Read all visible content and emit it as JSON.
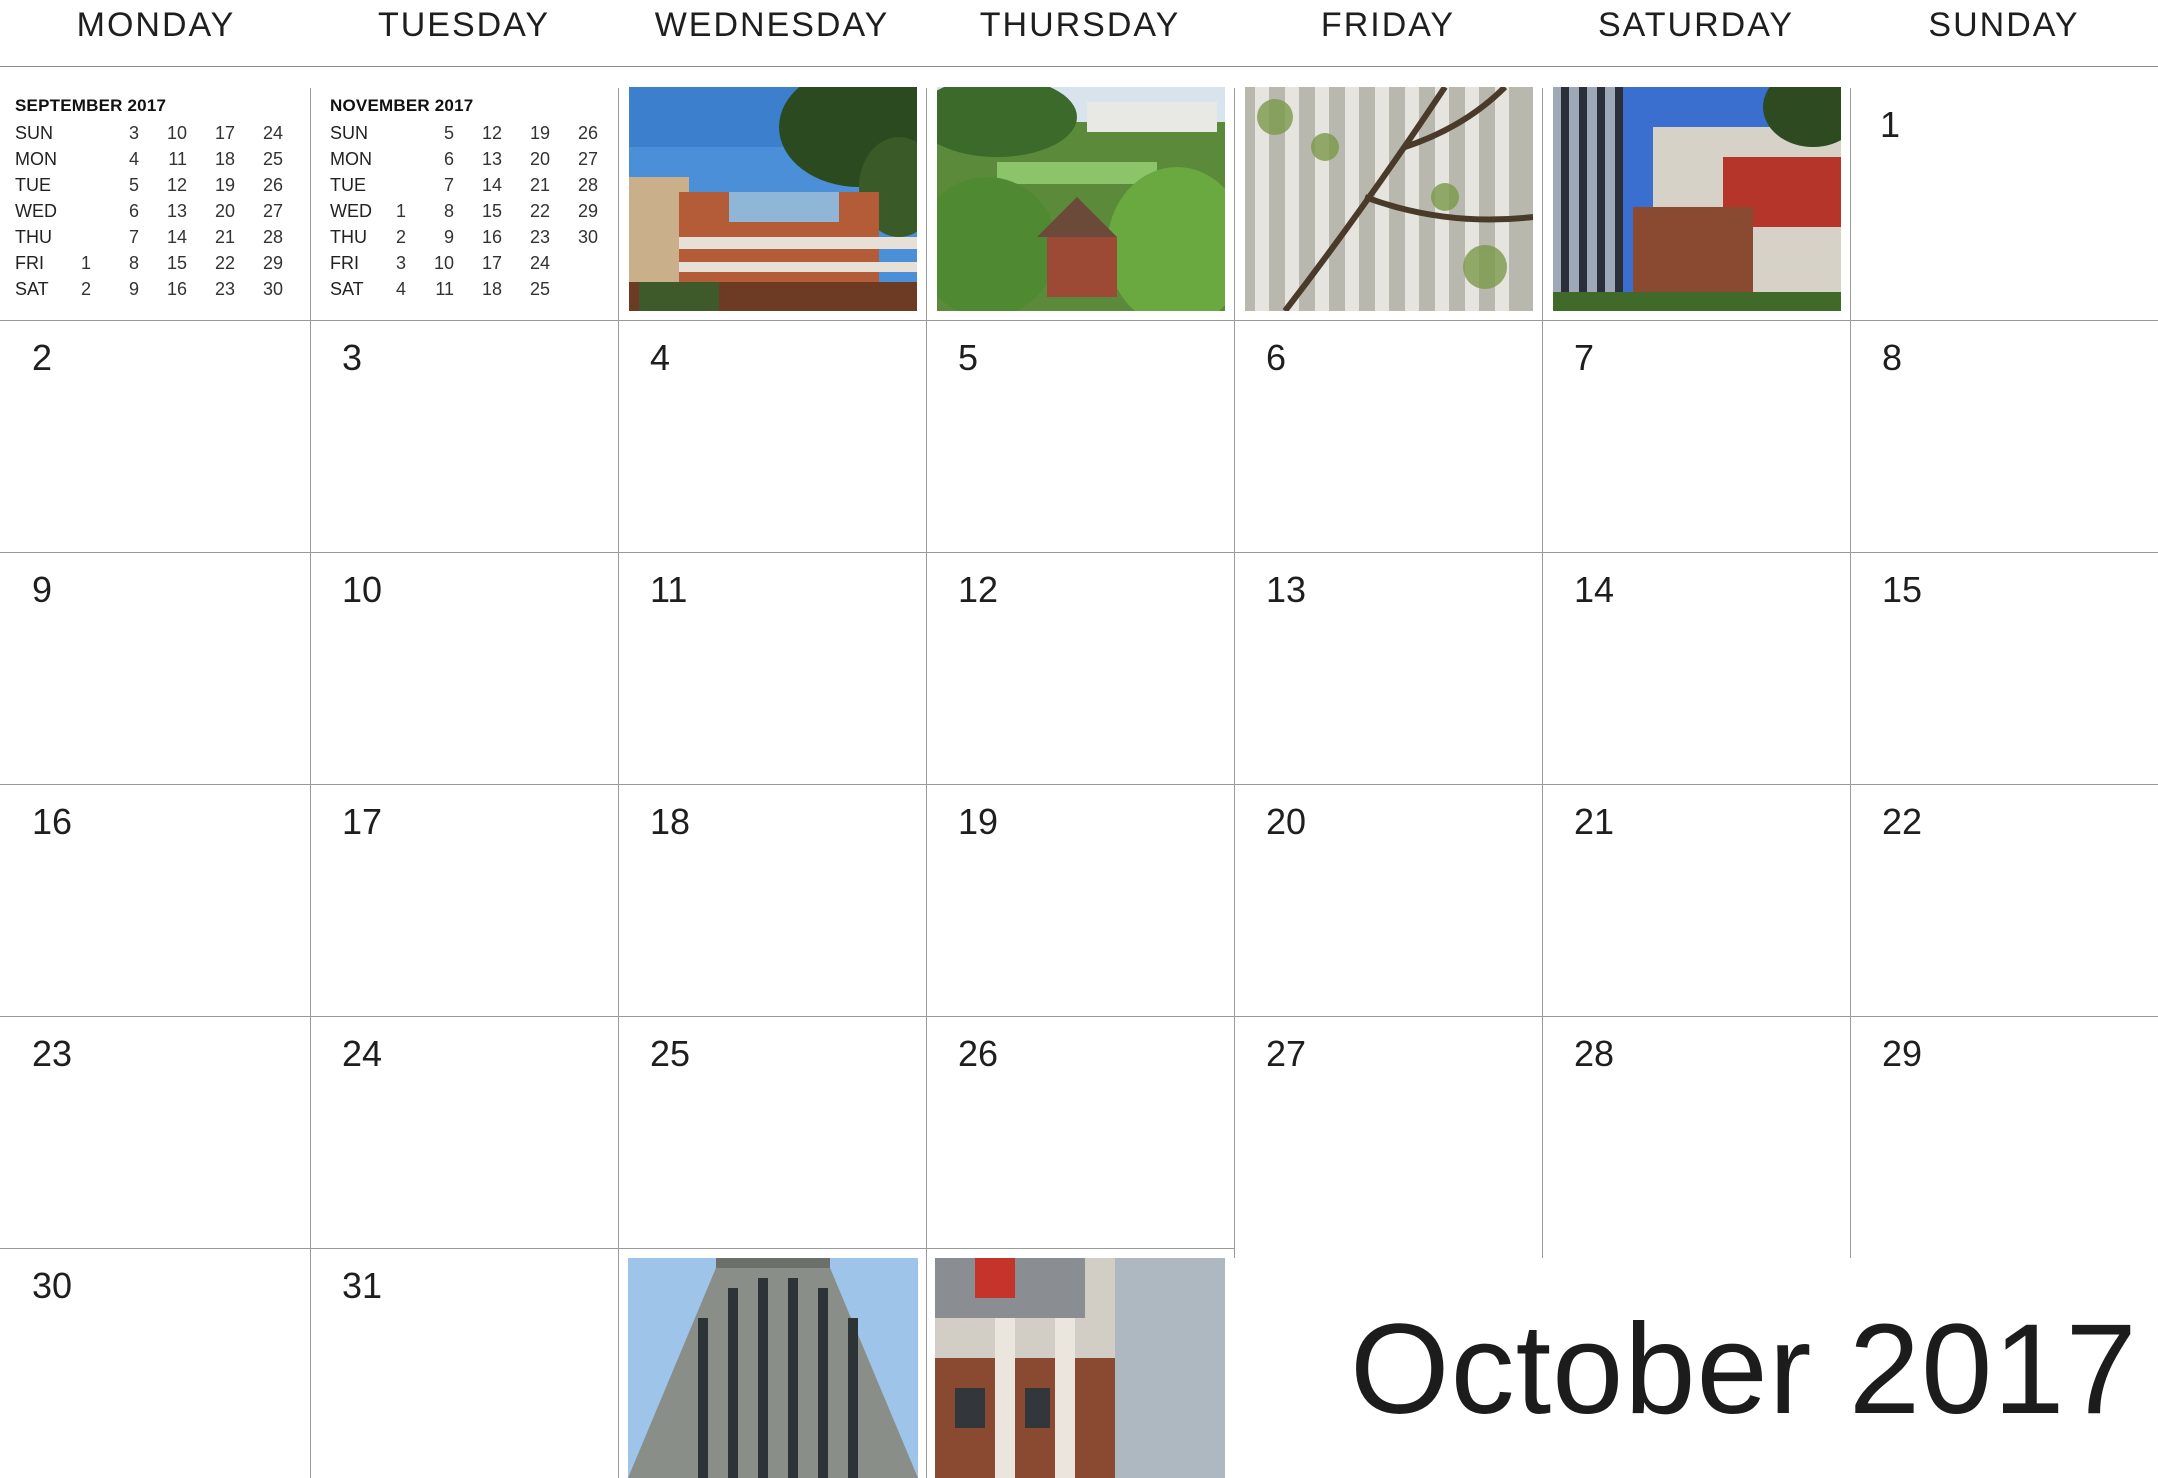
{
  "weekdays": [
    "MONDAY",
    "TUESDAY",
    "WEDNESDAY",
    "THURSDAY",
    "FRIDAY",
    "SATURDAY",
    "SUNDAY"
  ],
  "month_title": "October 2017",
  "days": [
    "1",
    "2",
    "3",
    "4",
    "5",
    "6",
    "7",
    "8",
    "9",
    "10",
    "11",
    "12",
    "13",
    "14",
    "15",
    "16",
    "17",
    "18",
    "19",
    "20",
    "21",
    "22",
    "23",
    "24",
    "25",
    "26",
    "27",
    "28",
    "29",
    "30",
    "31"
  ],
  "mini_calendars": [
    {
      "title": "SEPTEMBER 2017",
      "rows": [
        {
          "day": "SUN",
          "dates": [
            "",
            "3",
            "10",
            "17",
            "24"
          ]
        },
        {
          "day": "MON",
          "dates": [
            "",
            "4",
            "11",
            "18",
            "25"
          ]
        },
        {
          "day": "TUE",
          "dates": [
            "",
            "5",
            "12",
            "19",
            "26"
          ]
        },
        {
          "day": "WED",
          "dates": [
            "",
            "6",
            "13",
            "20",
            "27"
          ]
        },
        {
          "day": "THU",
          "dates": [
            "",
            "7",
            "14",
            "21",
            "28"
          ]
        },
        {
          "day": "FRI",
          "dates": [
            "1",
            "8",
            "15",
            "22",
            "29"
          ]
        },
        {
          "day": "SAT",
          "dates": [
            "2",
            "9",
            "16",
            "23",
            "30"
          ]
        }
      ]
    },
    {
      "title": "NOVEMBER 2017",
      "rows": [
        {
          "day": "SUN",
          "dates": [
            "",
            "5",
            "12",
            "19",
            "26"
          ]
        },
        {
          "day": "MON",
          "dates": [
            "",
            "6",
            "13",
            "20",
            "27"
          ]
        },
        {
          "day": "TUE",
          "dates": [
            "",
            "7",
            "14",
            "21",
            "28"
          ]
        },
        {
          "day": "WED",
          "dates": [
            "1",
            "8",
            "15",
            "22",
            "29"
          ]
        },
        {
          "day": "THU",
          "dates": [
            "2",
            "9",
            "16",
            "23",
            "30"
          ]
        },
        {
          "day": "FRI",
          "dates": [
            "3",
            "10",
            "17",
            "24",
            ""
          ]
        },
        {
          "day": "SAT",
          "dates": [
            "4",
            "11",
            "18",
            "25",
            ""
          ]
        }
      ]
    }
  ],
  "photos": [
    "building-photo",
    "park-photo",
    "tree-facade-photo",
    "tower-facade-photo",
    "tower-top-photo",
    "brick-building-photo"
  ]
}
